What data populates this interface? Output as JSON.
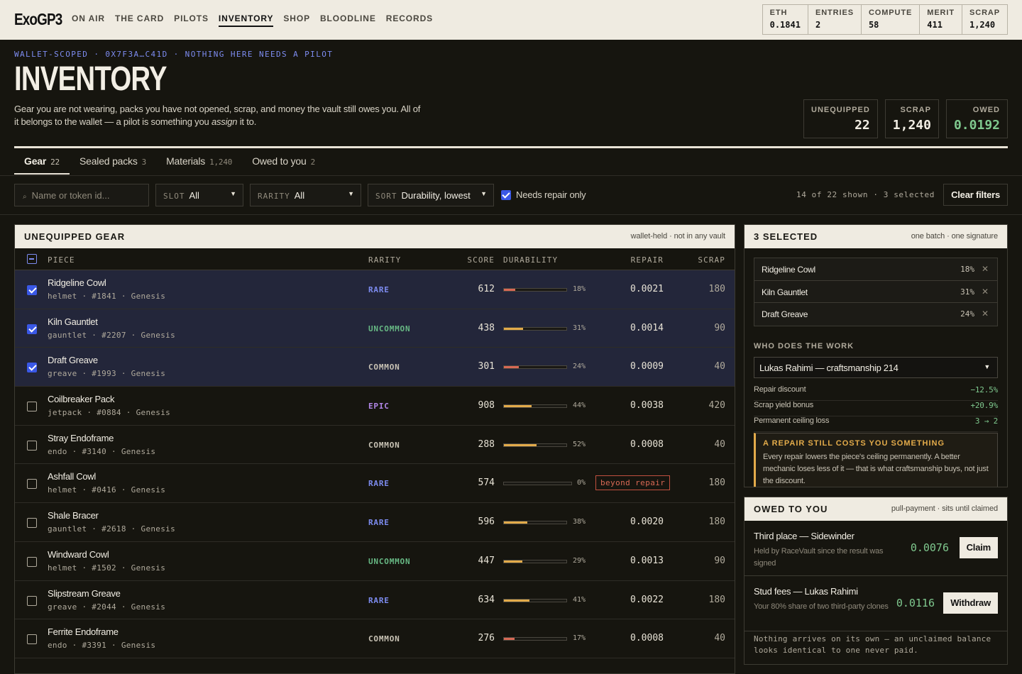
{
  "app": {
    "logo": "ExoGP3"
  },
  "nav": [
    {
      "label": "ON AIR",
      "active": false
    },
    {
      "label": "THE CARD",
      "active": false
    },
    {
      "label": "PILOTS",
      "active": false
    },
    {
      "label": "INVENTORY",
      "active": true
    },
    {
      "label": "SHOP",
      "active": false
    },
    {
      "label": "BLOODLINE",
      "active": false
    },
    {
      "label": "RECORDS",
      "active": false
    }
  ],
  "wallet": [
    {
      "label": "ETH",
      "value": "0.1841"
    },
    {
      "label": "ENTRIES",
      "value": "2"
    },
    {
      "label": "COMPUTE",
      "value": "58"
    },
    {
      "label": "MERIT",
      "value": "411"
    },
    {
      "label": "SCRAP",
      "value": "1,240"
    }
  ],
  "header": {
    "eyebrow": "WALLET-SCOPED · 0X7F3A…C41D · NOTHING HERE NEEDS A PILOT",
    "title": "INVENTORY",
    "lede_before": "Gear you are not wearing, packs you have not opened, scrap, and money the vault still owes you. All of it belongs to the wallet — a pilot is something you ",
    "lede_em": "assign",
    "lede_after": " it to."
  },
  "stats": [
    {
      "label": "UNEQUIPPED",
      "value": "22",
      "accent": false
    },
    {
      "label": "SCRAP",
      "value": "1,240",
      "accent": false
    },
    {
      "label": "OWED",
      "value": "0.0192",
      "accent": true
    }
  ],
  "tabs": [
    {
      "label": "Gear",
      "count": "22",
      "active": true
    },
    {
      "label": "Sealed packs",
      "count": "3",
      "active": false
    },
    {
      "label": "Materials",
      "count": "1,240",
      "active": false
    },
    {
      "label": "Owed to you",
      "count": "2",
      "active": false
    }
  ],
  "filters": {
    "search_placeholder": "Name or token id...",
    "slot_label": "SLOT",
    "slot_value": "All",
    "rarity_label": "RARITY",
    "rarity_value": "All",
    "sort_label": "SORT",
    "sort_value": "Durability, lowest",
    "repair_only_label": "Needs repair only",
    "shown_text": "14 of 22 shown · 3 selected",
    "clear_label": "Clear filters"
  },
  "gear_panel": {
    "title": "UNEQUIPPED GEAR",
    "subtitle": "wallet-held · not in any vault",
    "columns": {
      "piece": "PIECE",
      "rarity": "RARITY",
      "score": "SCORE",
      "durability": "DURABILITY",
      "repair": "REPAIR",
      "scrap": "SCRAP"
    },
    "rows": [
      {
        "name": "Ridgeline Cowl",
        "meta": "helmet · #1841 · Genesis",
        "rarity": "RARE",
        "rclass": "rare",
        "score": "612",
        "durability": 18,
        "durability_text": "18%",
        "repair": "0.0021",
        "scrap": "180",
        "selected": true
      },
      {
        "name": "Kiln Gauntlet",
        "meta": "gauntlet · #2207 · Genesis",
        "rarity": "UNCOMMON",
        "rclass": "uncommon",
        "score": "438",
        "durability": 31,
        "durability_text": "31%",
        "repair": "0.0014",
        "scrap": "90",
        "selected": true
      },
      {
        "name": "Draft Greave",
        "meta": "greave · #1993 · Genesis",
        "rarity": "COMMON",
        "rclass": "common",
        "score": "301",
        "durability": 24,
        "durability_text": "24%",
        "repair": "0.0009",
        "scrap": "40",
        "selected": true
      },
      {
        "name": "Coilbreaker Pack",
        "meta": "jetpack · #0884 · Genesis",
        "rarity": "EPIC",
        "rclass": "epic",
        "score": "908",
        "durability": 44,
        "durability_text": "44%",
        "repair": "0.0038",
        "scrap": "420",
        "selected": false
      },
      {
        "name": "Stray Endoframe",
        "meta": "endo · #3140 · Genesis",
        "rarity": "COMMON",
        "rclass": "common",
        "score": "288",
        "durability": 52,
        "durability_text": "52%",
        "repair": "0.0008",
        "scrap": "40",
        "selected": false
      },
      {
        "name": "Ashfall Cowl",
        "meta": "helmet · #0416 · Genesis",
        "rarity": "RARE",
        "rclass": "rare",
        "score": "574",
        "durability": 0,
        "durability_text": "0%",
        "repair": "beyond repair",
        "scrap": "180",
        "selected": false,
        "beyond": true
      },
      {
        "name": "Shale Bracer",
        "meta": "gauntlet · #2618 · Genesis",
        "rarity": "RARE",
        "rclass": "rare",
        "score": "596",
        "durability": 38,
        "durability_text": "38%",
        "repair": "0.0020",
        "scrap": "180",
        "selected": false
      },
      {
        "name": "Windward Cowl",
        "meta": "helmet · #1502 · Genesis",
        "rarity": "UNCOMMON",
        "rclass": "uncommon",
        "score": "447",
        "durability": 29,
        "durability_text": "29%",
        "repair": "0.0013",
        "scrap": "90",
        "selected": false
      },
      {
        "name": "Slipstream Greave",
        "meta": "greave · #2044 · Genesis",
        "rarity": "RARE",
        "rclass": "rare",
        "score": "634",
        "durability": 41,
        "durability_text": "41%",
        "repair": "0.0022",
        "scrap": "180",
        "selected": false
      },
      {
        "name": "Ferrite Endoframe",
        "meta": "endo · #3391 · Genesis",
        "rarity": "COMMON",
        "rclass": "common",
        "score": "276",
        "durability": 17,
        "durability_text": "17%",
        "repair": "0.0008",
        "scrap": "40",
        "selected": false
      }
    ]
  },
  "selection": {
    "title": "3 SELECTED",
    "subtitle": "one batch · one signature",
    "items": [
      {
        "name": "Ridgeline Cowl",
        "pct": "18%"
      },
      {
        "name": "Kiln Gauntlet",
        "pct": "31%"
      },
      {
        "name": "Draft Greave",
        "pct": "24%"
      }
    ],
    "worker_heading": "WHO DOES THE WORK",
    "worker": "Lukas Rahimi — craftsmanship 214",
    "stats": [
      {
        "label": "Repair discount",
        "value": "−12.5%"
      },
      {
        "label": "Scrap yield bonus",
        "value": "+20.9%"
      },
      {
        "label": "Permanent ceiling loss",
        "value": "3 → 2"
      }
    ],
    "warning_title": "A REPAIR STILL COSTS YOU SOMETHING",
    "warning_body": "Every repair lowers the piece's ceiling permanently. A better mechanic loses less of it — that is what craftsmanship buys, not just the discount."
  },
  "owed": {
    "title": "OWED TO YOU",
    "subtitle": "pull-payment · sits until claimed",
    "items": [
      {
        "title": "Third place — Sidewinder",
        "desc": "Held by RaceVault since the result was signed",
        "amount": "0.0076",
        "action": "Claim"
      },
      {
        "title": "Stud fees — Lukas Rahimi",
        "desc": "Your 80% share of two third-party clones",
        "amount": "0.0116",
        "action": "Withdraw"
      }
    ],
    "footer": "Nothing arrives on its own — an unclaimed balance looks identical to one never paid."
  }
}
